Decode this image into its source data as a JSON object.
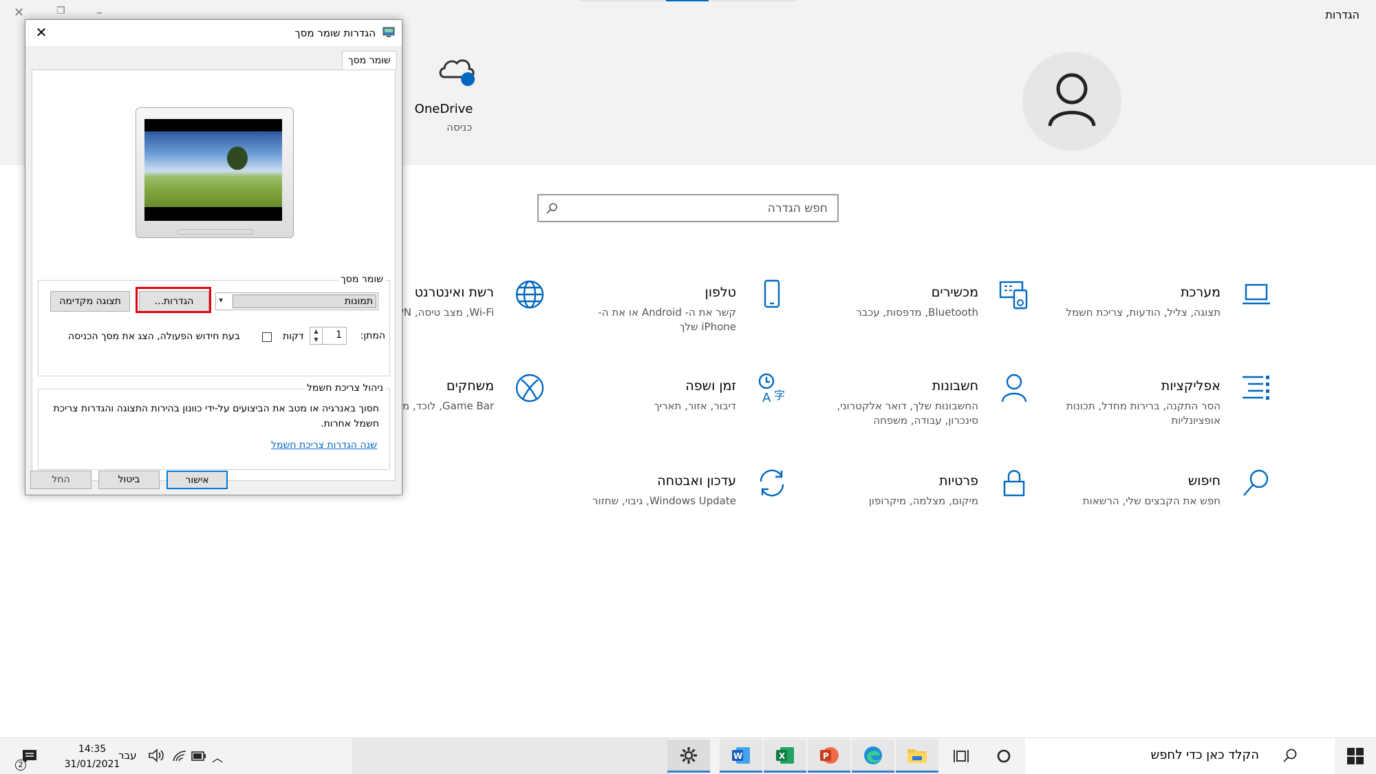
{
  "window": {
    "title": "הגדרות"
  },
  "account": {
    "onedrive_label": "OneDrive",
    "onedrive_sub": "כניסה"
  },
  "search": {
    "placeholder": "חפש הגדרה"
  },
  "tiles": [
    {
      "title": "מערכת",
      "desc": "תצוגה, צליל, הודעות, צריכת חשמל",
      "icon": "laptop-icon"
    },
    {
      "title": "מכשירים",
      "desc": "Bluetooth, מדפסות, עכבר",
      "icon": "devices-icon"
    },
    {
      "title": "טלפון",
      "desc": "קשר את ה- Android או את ה-iPhone שלך",
      "icon": "phone-icon"
    },
    {
      "title": "רשת ואינטרנט",
      "desc": "Wi-Fi, מצב טיסה, VPN",
      "icon": "globe-icon"
    },
    {
      "title": "אפליקציות",
      "desc": "הסר התקנה, ברירות מחדל, תכונות אופציונליות",
      "icon": "apps-list-icon"
    },
    {
      "title": "חשבונות",
      "desc": "החשבונות שלך, דואר אלקטרוני, סינכרון, עבודה, משפחה",
      "icon": "person-icon"
    },
    {
      "title": "זמן ושפה",
      "desc": "דיבור, אזור, תאריך",
      "icon": "time-language-icon"
    },
    {
      "title": "משחקים",
      "desc": "Game Bar, לוכד, מצב משחק",
      "icon": "xbox-icon"
    },
    {
      "title": "חיפוש",
      "desc": "חפש את הקבצים שלי, הרשאות",
      "icon": "search-icon"
    },
    {
      "title": "פרטיות",
      "desc": "מיקום, מצלמה, מיקרופון",
      "icon": "lock-icon"
    },
    {
      "title": "עדכון ואבטחה",
      "desc": "Windows Update, גיבוי, שחזור",
      "icon": "sync-icon"
    }
  ],
  "dialog": {
    "title": "הגדרות שומר מסך",
    "tab": "שומר מסך",
    "group_screensaver": "שומר מסך",
    "combo_value": "תמונות",
    "settings_button": "הגדרות...",
    "preview_button": "תצוגה מקדימה",
    "wait_label": "המתן:",
    "wait_value": "1",
    "minutes_label": "דקות",
    "resume_label": "בעת חידוש הפעולה, הצג את מסך הכניסה",
    "power_group": "ניהול צריכת חשמל",
    "power_text": "חסוך באנרגיה או מטב את הביצועים על-ידי כוונון בהירות התצוגה והגדרות צריכת חשמל אחרות.",
    "power_link": "שנה הגדרות צריכת חשמל",
    "ok": "אישור",
    "cancel": "ביטול",
    "apply": "החל"
  },
  "taskbar": {
    "search_placeholder": "הקלד כאן כדי לחפש",
    "time": "14:35",
    "date": "31/01/2021",
    "language": "עבר",
    "notification_count": "2"
  }
}
